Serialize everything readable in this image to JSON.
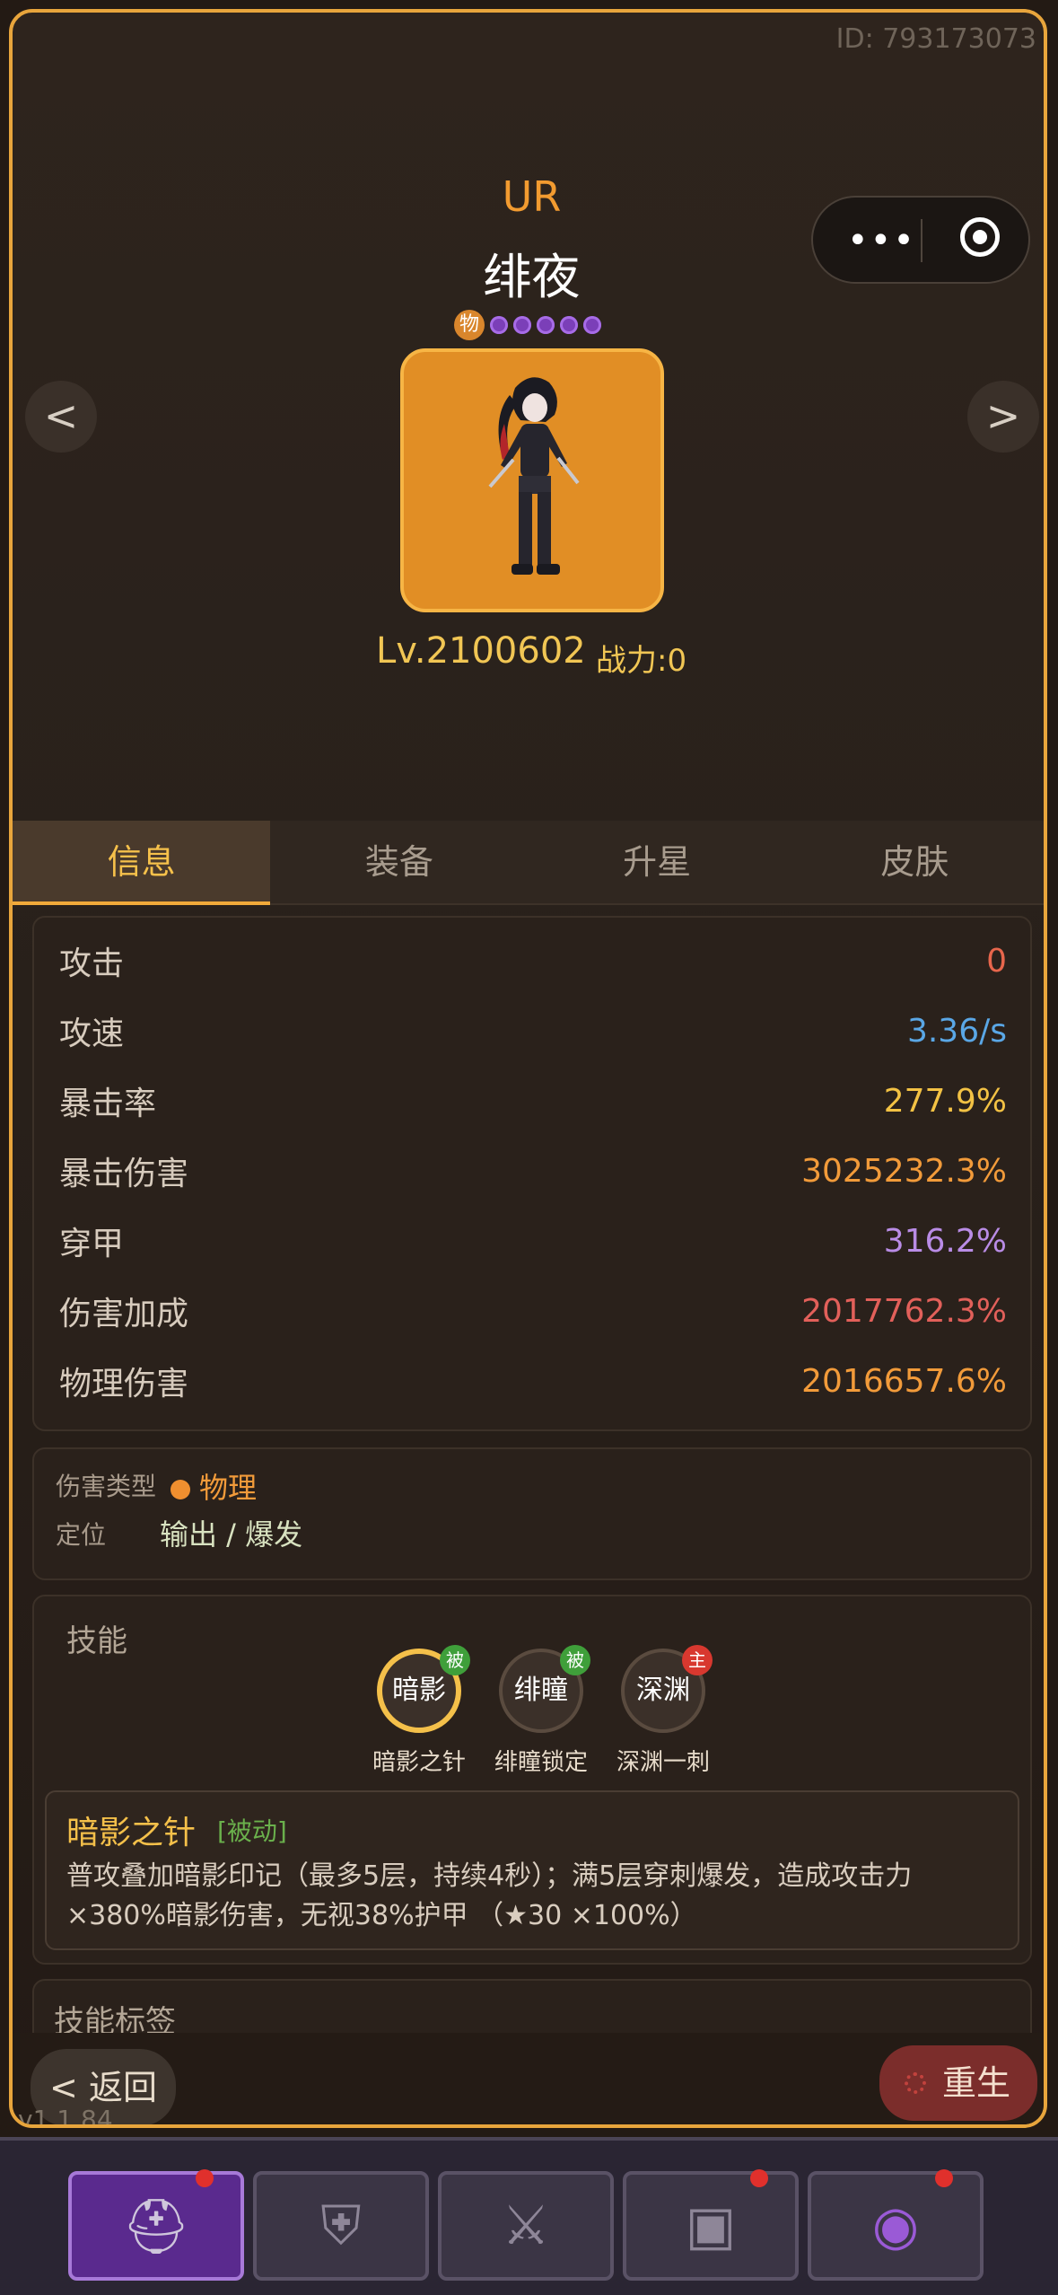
{
  "header": {
    "id_label": "ID: 793173073",
    "rarity": "UR",
    "name": "绯夜",
    "damage_type_badge": "物",
    "star_count": 5,
    "prev_label": "<",
    "next_label": ">",
    "level": "Lv.2100602",
    "power": "战力:0"
  },
  "miniapp_capsule": {
    "more_icon": "more-dots-icon",
    "close_icon": "target-circle-icon"
  },
  "tabs": [
    {
      "label": "信息",
      "active": true
    },
    {
      "label": "装备",
      "active": false
    },
    {
      "label": "升星",
      "active": false
    },
    {
      "label": "皮肤",
      "active": false
    }
  ],
  "stats": [
    {
      "name": "攻击",
      "value": "0",
      "color": "#e7664c"
    },
    {
      "name": "攻速",
      "value": "3.36/s",
      "color": "#5aa7e6"
    },
    {
      "name": "暴击率",
      "value": "277.9%",
      "color": "#f3c244"
    },
    {
      "name": "暴击伤害",
      "value": "3025232.3%",
      "color": "#f29b3a"
    },
    {
      "name": "穿甲",
      "value": "316.2%",
      "color": "#b98ce6"
    },
    {
      "name": "伤害加成",
      "value": "2017762.3%",
      "color": "#e2605a"
    },
    {
      "name": "物理伤害",
      "value": "2016657.6%",
      "color": "#f29b3a"
    }
  ],
  "info": {
    "damage_type_label": "伤害类型",
    "damage_type_value": "物理",
    "role_label": "定位",
    "role_value": "输出 / 爆发"
  },
  "skills": {
    "title": "技能",
    "items": [
      {
        "icon_text": "暗影",
        "badge": "被",
        "badge_color": "#3f9f3a",
        "name": "暗影之针",
        "selected": true
      },
      {
        "icon_text": "绯瞳",
        "badge": "被",
        "badge_color": "#3f9f3a",
        "name": "绯瞳锁定",
        "selected": false
      },
      {
        "icon_text": "深渊",
        "badge": "主",
        "badge_color": "#d8382f",
        "name": "深渊一刺",
        "selected": false
      }
    ],
    "detail": {
      "name": "暗影之针",
      "tag": "[被动]",
      "description": "普攻叠加暗影印记（最多5层，持续4秒）；满5层穿刺爆发，造成攻击力×380%暗影伤害，无视38%护甲 （★30 ×100%）"
    }
  },
  "skill_tags": {
    "title": "技能标签"
  },
  "footer": {
    "back_label": "< 返回",
    "version": "v1.1.84",
    "rebirth_label": "重生"
  },
  "bottom_nav": [
    {
      "icon": "knight-helmet-icon",
      "active": true,
      "red_dot": true
    },
    {
      "icon": "shield-emblem-icon",
      "active": false,
      "red_dot": false
    },
    {
      "icon": "crossed-swords-icon",
      "active": false,
      "red_dot": false
    },
    {
      "icon": "treasure-chest-icon",
      "active": false,
      "red_dot": true
    },
    {
      "icon": "purple-portal-icon",
      "active": false,
      "red_dot": true
    }
  ]
}
